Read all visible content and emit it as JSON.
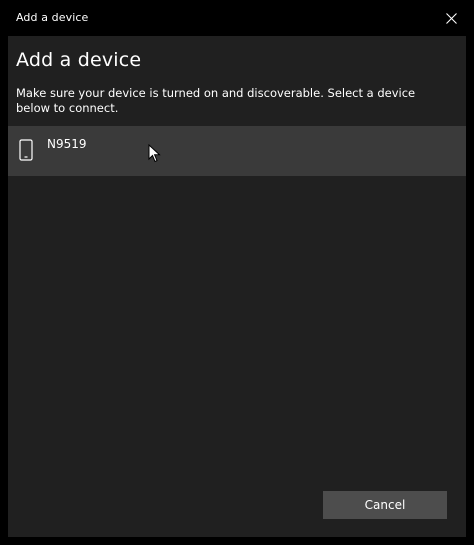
{
  "window": {
    "title": "Add a device"
  },
  "dialog": {
    "heading": "Add a device",
    "instructions": "Make sure your device is turned on and discoverable. Select a device below to connect."
  },
  "devices": [
    {
      "name": "N9519",
      "icon": "phone-icon"
    }
  ],
  "buttons": {
    "cancel_label": "Cancel"
  },
  "colors": {
    "window_background": "#000000",
    "content_background": "#202020",
    "selected_item_background": "#3a3a3a",
    "button_background": "#4d4d4d",
    "text": "#ffffff"
  }
}
